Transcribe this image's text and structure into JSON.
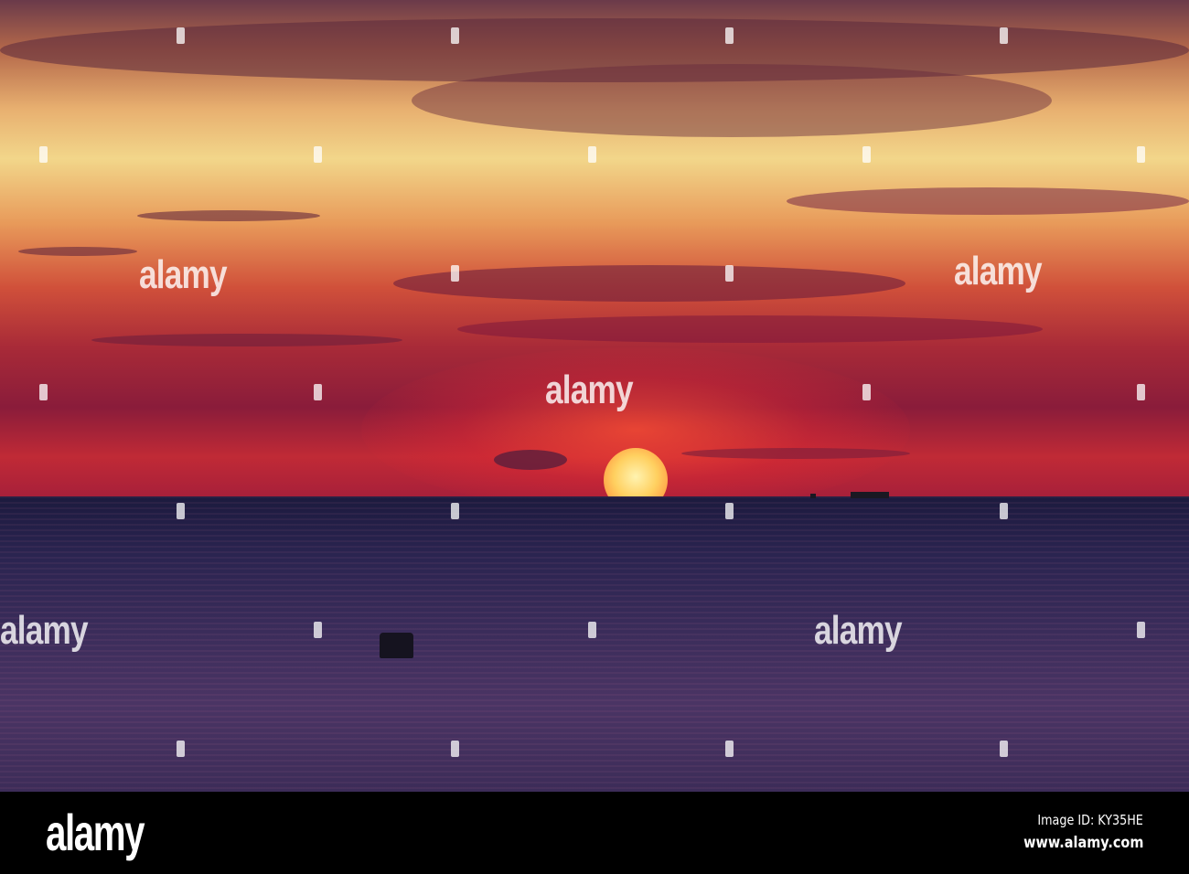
{
  "watermark": {
    "text": "alamy"
  },
  "footer": {
    "logo": "alamy",
    "image_id": "Image ID: KY35HE",
    "website": "www.alamy.com"
  },
  "colors": {
    "sun": "#ffd060",
    "sky_top": "#6a3a4a",
    "sky_horizon": "#a8203a",
    "sea": "#2a2450"
  }
}
